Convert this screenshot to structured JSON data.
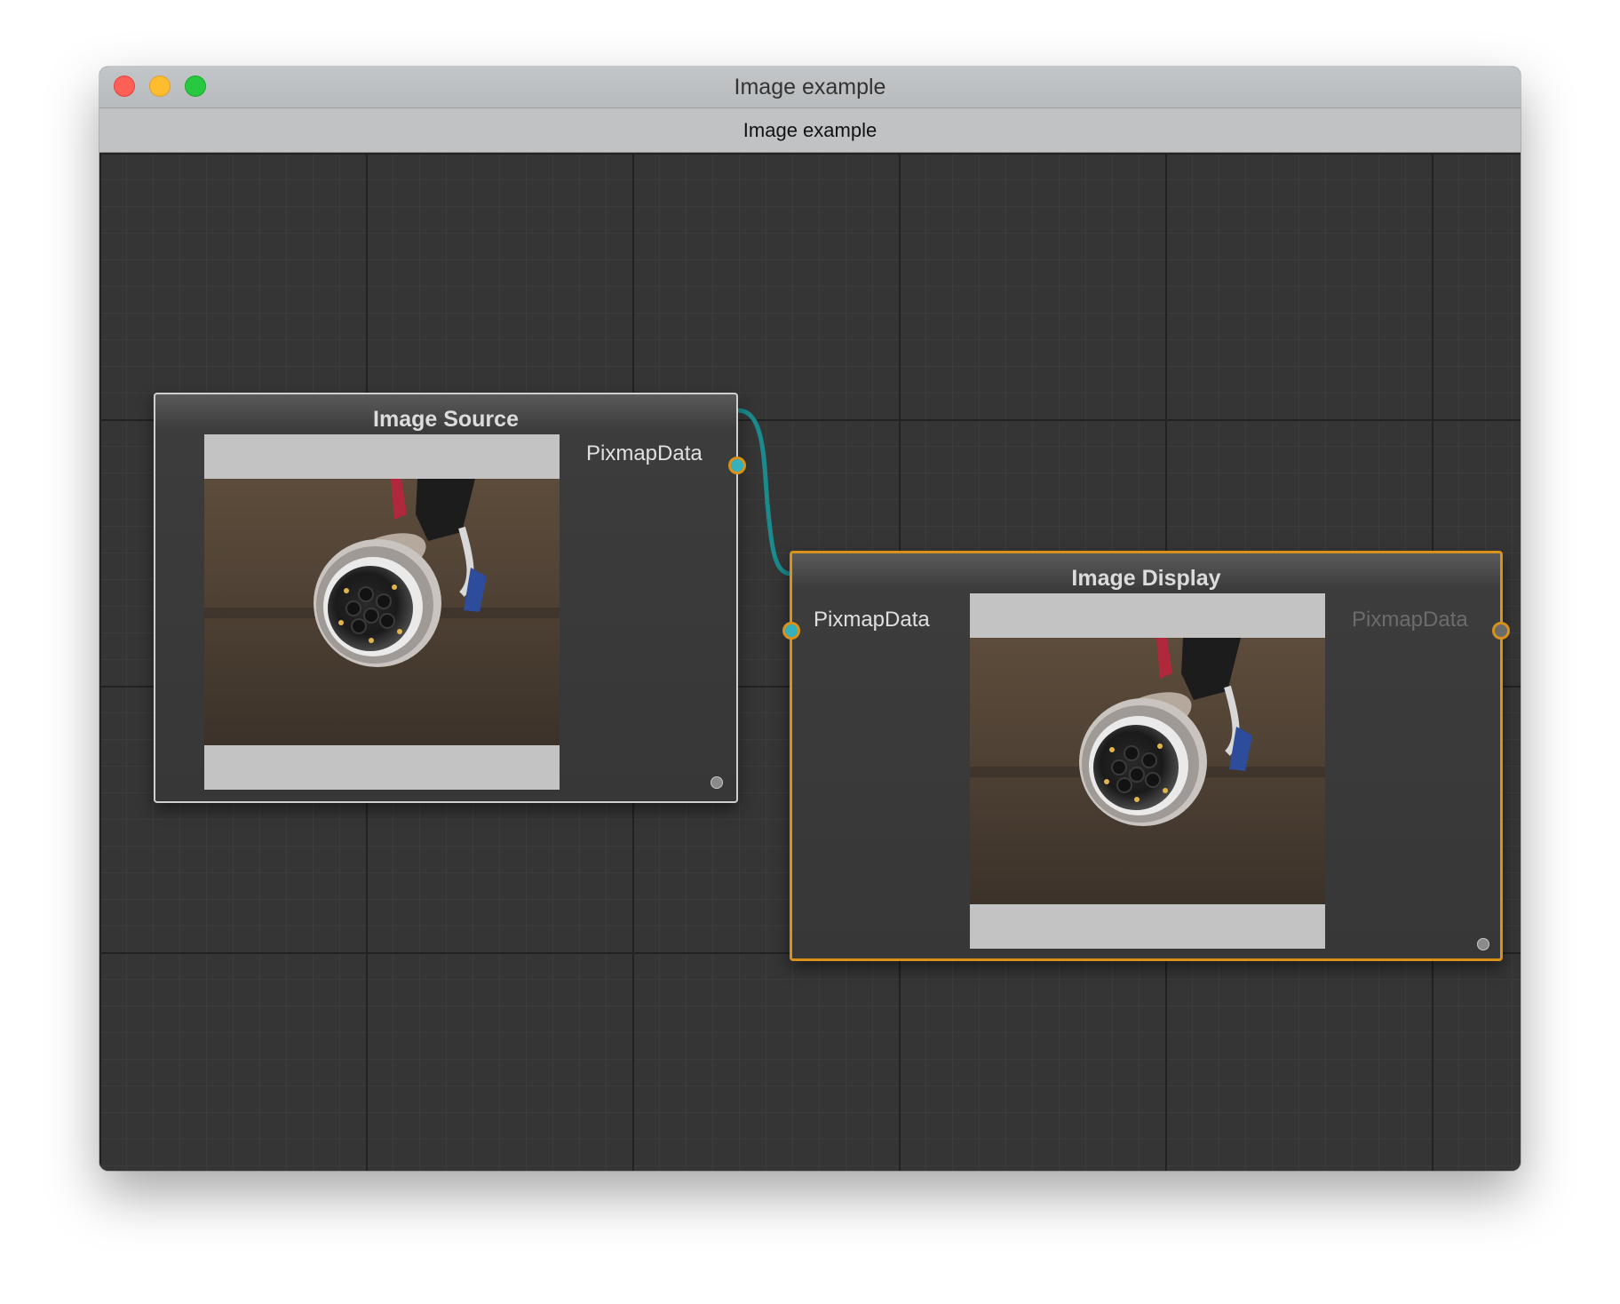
{
  "window": {
    "title": "Image example",
    "tab_title": "Image example"
  },
  "nodes": {
    "source": {
      "caption": "Image Source",
      "output_port_label": "PixmapData"
    },
    "display": {
      "caption": "Image Display",
      "input_port_label": "PixmapData",
      "output_port_label": "PixmapData"
    }
  },
  "colors": {
    "selected_node_border": "#d8921b",
    "connection": "#1a8a8c",
    "connected_port_fill": "#36b0ba",
    "canvas_background": "#353535"
  },
  "icons": {
    "close": "close-icon",
    "minimize": "minimize-icon",
    "maximize": "maximize-icon"
  }
}
